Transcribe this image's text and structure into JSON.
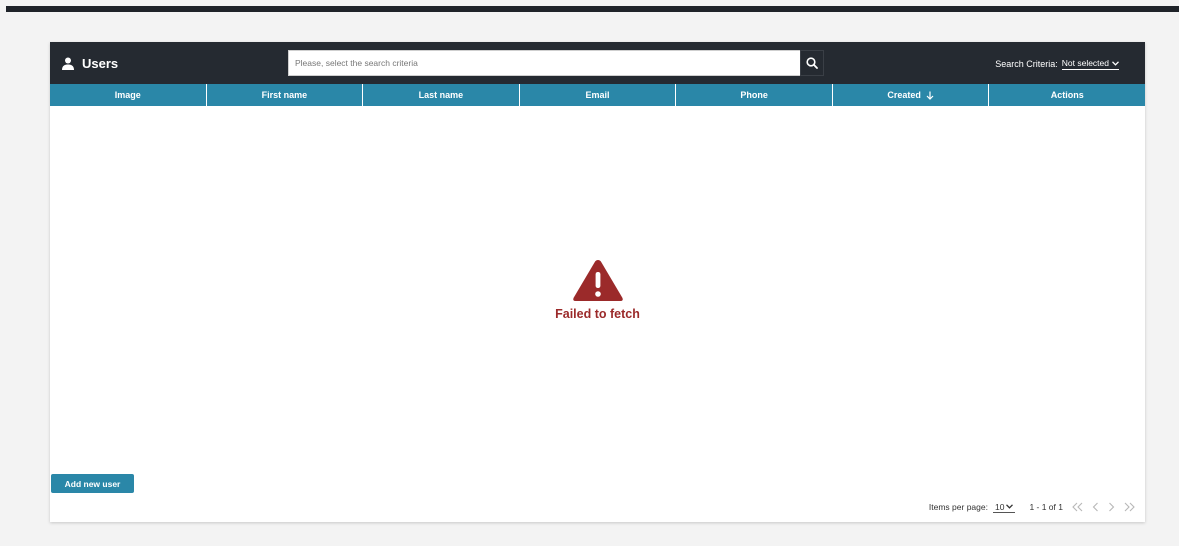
{
  "header": {
    "title": "Users",
    "search_placeholder": "Please, select the search criteria",
    "criteria_label": "Search Criteria:",
    "criteria_value": "Not selected"
  },
  "table": {
    "columns": [
      "Image",
      "First name",
      "Last name",
      "Email",
      "Phone",
      "Created",
      "Actions"
    ],
    "sorted_column": "Created",
    "sort_direction": "descending"
  },
  "error": {
    "message": "Failed to fetch",
    "color": "#9b2a2a"
  },
  "actions": {
    "add_label": "Add new user"
  },
  "pagination": {
    "items_per_page_label": "Items per page:",
    "items_per_page_value": "10",
    "range_label": "1 - 1 of 1"
  },
  "colors": {
    "header_bg": "#252a31",
    "accent": "#2a87a8"
  }
}
